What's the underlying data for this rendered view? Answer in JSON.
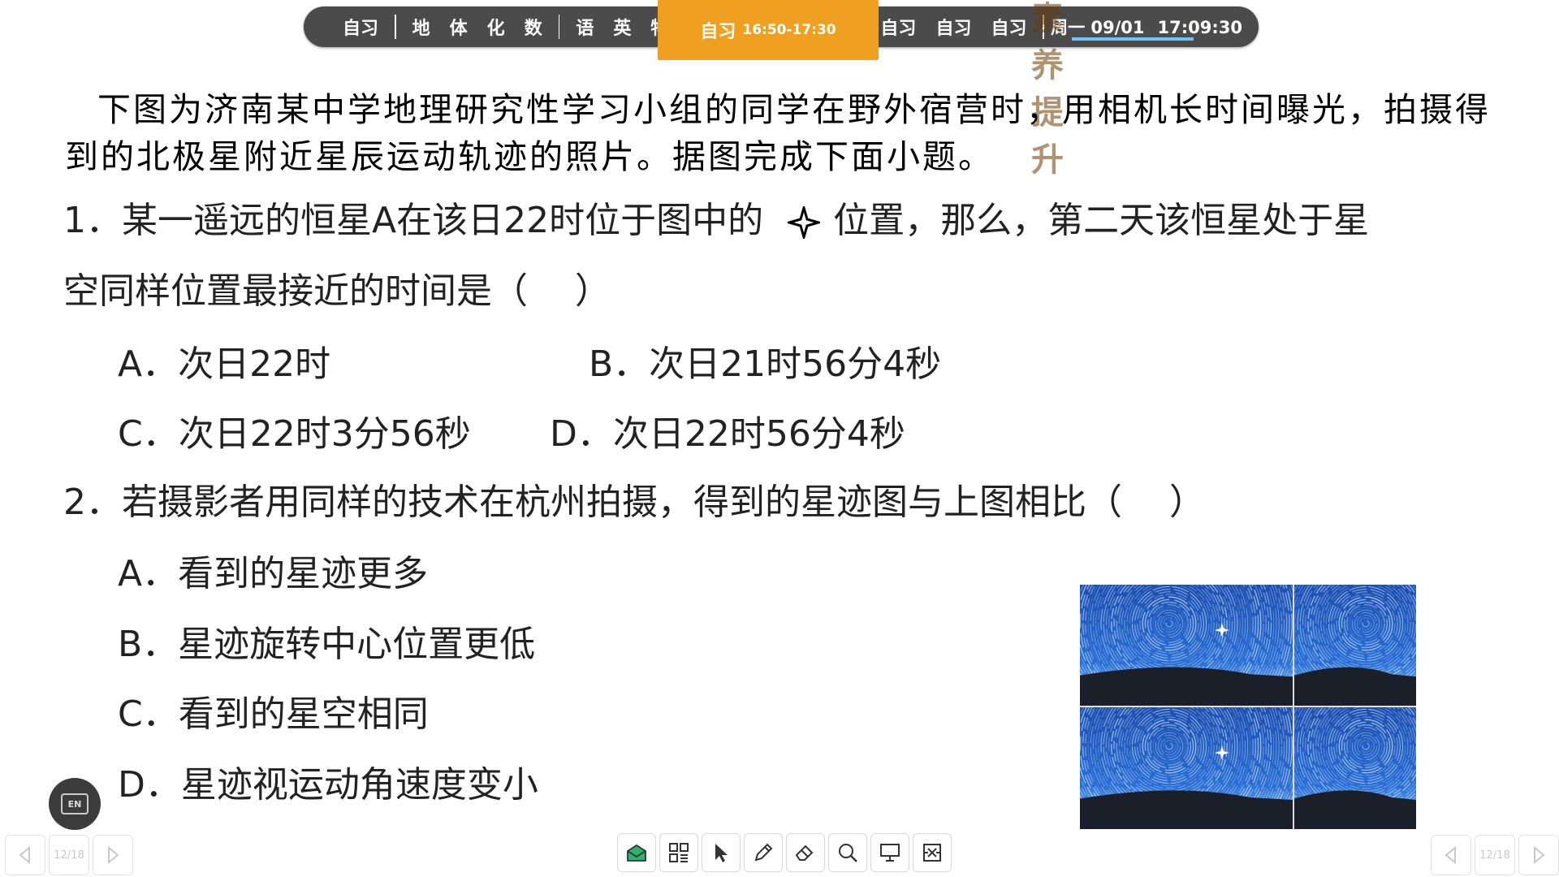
{
  "schedule": {
    "items_left": [
      "自习"
    ],
    "items_subjects": [
      "地",
      "体",
      "化",
      "数"
    ],
    "items_lang": [
      "语",
      "英",
      "物"
    ],
    "current": {
      "label": "自习",
      "time": "16:50-17:30",
      "ghost_text": "素养提升"
    },
    "items_right": [
      "自习",
      "自习",
      "自习"
    ],
    "date": "周一 09/01",
    "time": "17:09:30"
  },
  "slide": {
    "intro": "下图为济南某中学地理研究性学习小组的同学在野外宿营时，用相机长时间曝光，拍摄得到的北极星附近星辰运动轨迹的照片。据图完成下面小题。",
    "q1": {
      "line1_before": "1．某一遥远的恒星A在该日22时位于图中的",
      "line1_after": "位置，那么，第二天该恒星处于星",
      "line2": "空同样位置最接近的时间是（　 ）",
      "A": "A．次日22时",
      "B": "B．次日21时56分4秒",
      "C": "C．次日22时3分56秒",
      "D": "D．次日22时56分4秒"
    },
    "q2": {
      "stem": "2．若摄影者用同样的技术在杭州拍摄，得到的星迹图与上图相比（　 ）",
      "A": "A．看到的星迹更多",
      "B": "B．星迹旋转中心位置更低",
      "C": "C．看到的星空相同",
      "D": "D．星迹视运动角速度变小"
    }
  },
  "lang_badge": "EN",
  "pager": {
    "page": "12/18"
  },
  "icons": {
    "toolbar": [
      "whiteboard-icon",
      "apps-icon",
      "pointer-icon",
      "pen-icon",
      "eraser-icon",
      "zoom-icon",
      "projector-icon",
      "exit-icon"
    ]
  },
  "colors": {
    "bar": "#4b4b4b",
    "current": "#f0a020",
    "progress": "#6cc3f5"
  }
}
